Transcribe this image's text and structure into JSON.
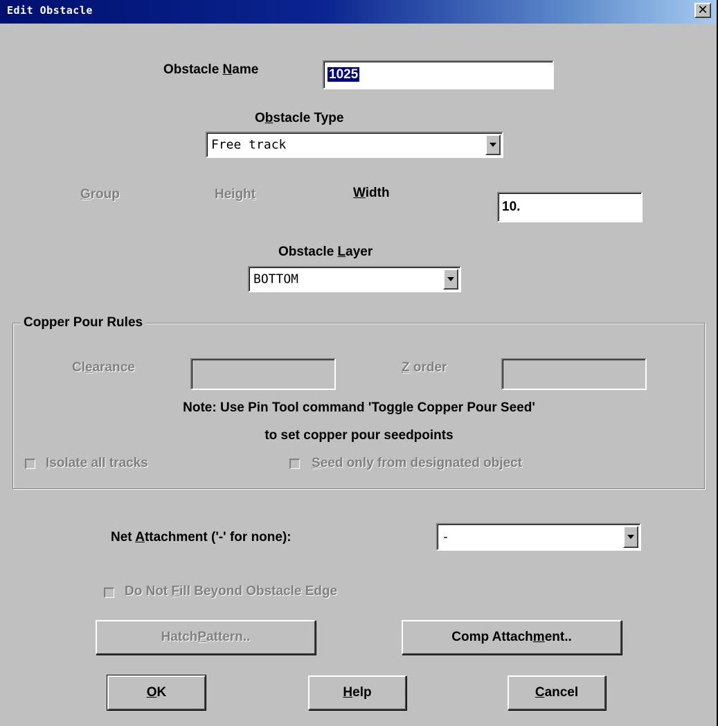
{
  "window": {
    "title": "Edit Obstacle",
    "close_glyph": "✕"
  },
  "obstacle_name": {
    "label_pre": "Obstacle ",
    "label_key": "N",
    "label_post": "ame",
    "value": "1025"
  },
  "obstacle_type": {
    "label_pre": "O",
    "label_key": "b",
    "label_post": "stacle Type",
    "selected": "Free track"
  },
  "dimensions": {
    "group_key": "G",
    "group_post": "roup",
    "height_pre": "Heigh",
    "height_key": "t",
    "width_key": "W",
    "width_post": "idth",
    "width_value": "10."
  },
  "obstacle_layer": {
    "label_pre": "Obstacle ",
    "label_key": "L",
    "label_post": "ayer",
    "selected": "BOTTOM"
  },
  "copper_pour": {
    "group_title": "Copper Pour Rules",
    "clearance_pre": "Cl",
    "clearance_key": "e",
    "clearance_post": "arance",
    "clearance_value": "",
    "zorder_key": "Z",
    "zorder_post": " order",
    "zorder_value": "",
    "note_line1": "Note: Use Pin Tool command 'Toggle Copper Pour Seed'",
    "note_line2": "to set copper pour seedpoints",
    "isolate_key": "I",
    "isolate_post": "solate all tracks",
    "isolate_checked": false,
    "seed_key": "S",
    "seed_post": "eed only from designated object",
    "seed_checked": false
  },
  "net_attachment": {
    "label_pre": "Net ",
    "label_key": "A",
    "label_post": "ttachment ('-' for none):",
    "selected": "-"
  },
  "do_not_fill": {
    "label_pre": "Do Not ",
    "label_key": "F",
    "label_post": "ill Beyond Obstacle Edge",
    "checked": false
  },
  "buttons": {
    "hatch_pre": "Hatch ",
    "hatch_key": "P",
    "hatch_post": "attern..",
    "comp_pre": "Comp Attach",
    "comp_key": "m",
    "comp_post": "ent..",
    "ok_key": "O",
    "ok_post": "K",
    "help_key": "H",
    "help_post": "elp",
    "cancel_key": "C",
    "cancel_post": "ancel"
  }
}
